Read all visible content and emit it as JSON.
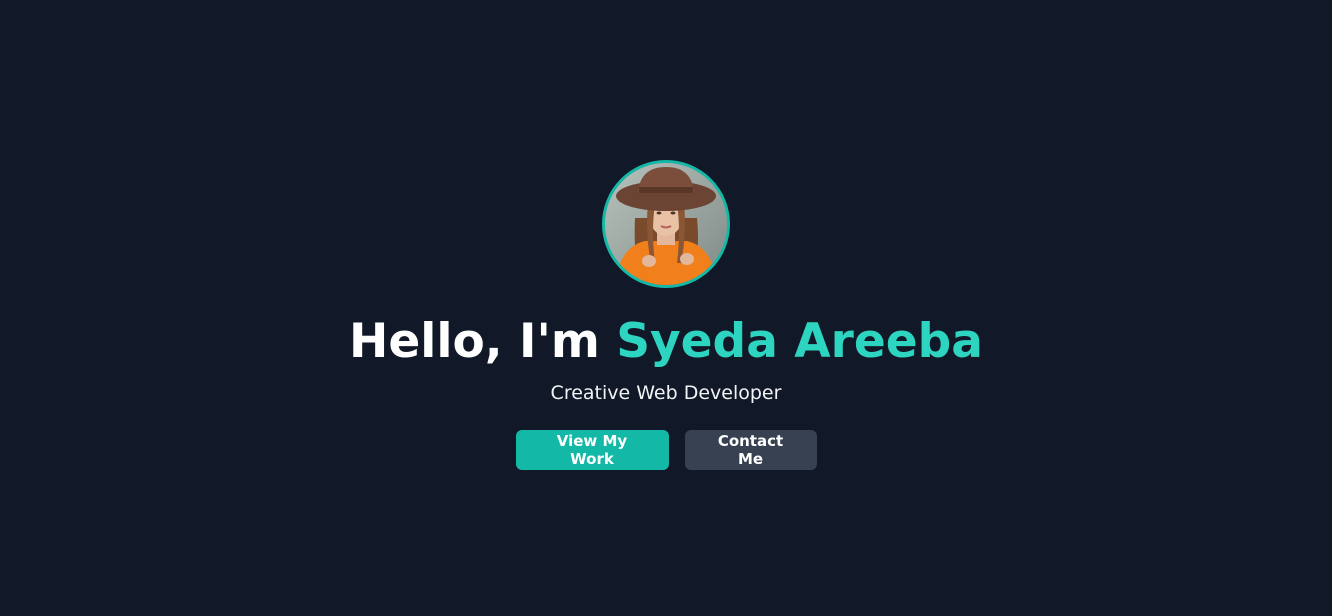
{
  "hero": {
    "greeting": "Hello, I'm ",
    "name": "Syeda Areeba",
    "subtitle": "Creative Web Developer",
    "avatar_alt": "profile-photo"
  },
  "actions": {
    "primary_label": "View My Work",
    "secondary_label": "Contact Me"
  },
  "colors": {
    "background": "#111827",
    "accent": "#14b8a6",
    "name_accent": "#2dd4bf",
    "secondary_button": "#374151"
  }
}
